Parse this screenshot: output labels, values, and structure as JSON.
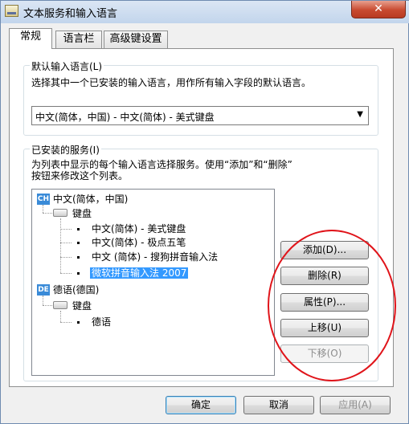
{
  "window": {
    "title": "文本服务和输入语言",
    "close_glyph": "✕"
  },
  "tabs": [
    {
      "label": "常规",
      "active": true
    },
    {
      "label": "语言栏",
      "active": false
    },
    {
      "label": "高级键设置",
      "active": false
    }
  ],
  "default_language": {
    "group_title": "默认输入语言(L)",
    "description": "选择其中一个已安装的输入语言，用作所有输入字段的默认语言。",
    "selected_value": "中文(简体，中国) - 中文(简体) - 美式键盘",
    "dropdown_glyph": "▼"
  },
  "installed_services": {
    "group_title": "已安装的服务(I)",
    "description_line1": "为列表中显示的每个输入语言选择服务。使用“添加”和“删除”",
    "description_line2": "按钮来修改这个列表。",
    "tree": {
      "lang1": {
        "badge": "CH",
        "label": "中文(简体，中国)"
      },
      "lang1_category": "键盘",
      "lang1_items": [
        "中文(简体) - 美式键盘",
        "中文(简体) - 极点五笔",
        "中文 (简体) - 搜狗拼音输入法",
        "微软拼音输入法 2007"
      ],
      "lang2": {
        "badge": "DE",
        "label": "德语(德国)"
      },
      "lang2_category": "键盘",
      "lang2_items": [
        "德语"
      ]
    },
    "buttons": {
      "add": "添加(D)...",
      "remove": "删除(R)",
      "properties": "属性(P)...",
      "move_up": "上移(U)",
      "move_down": "下移(O)"
    }
  },
  "footer": {
    "ok": "确定",
    "cancel": "取消",
    "apply_partial": "应用(A)"
  },
  "colors": {
    "selection": "#3399ff",
    "annotation_circle": "#e0141a",
    "language_badge": "#3a8bd8"
  }
}
